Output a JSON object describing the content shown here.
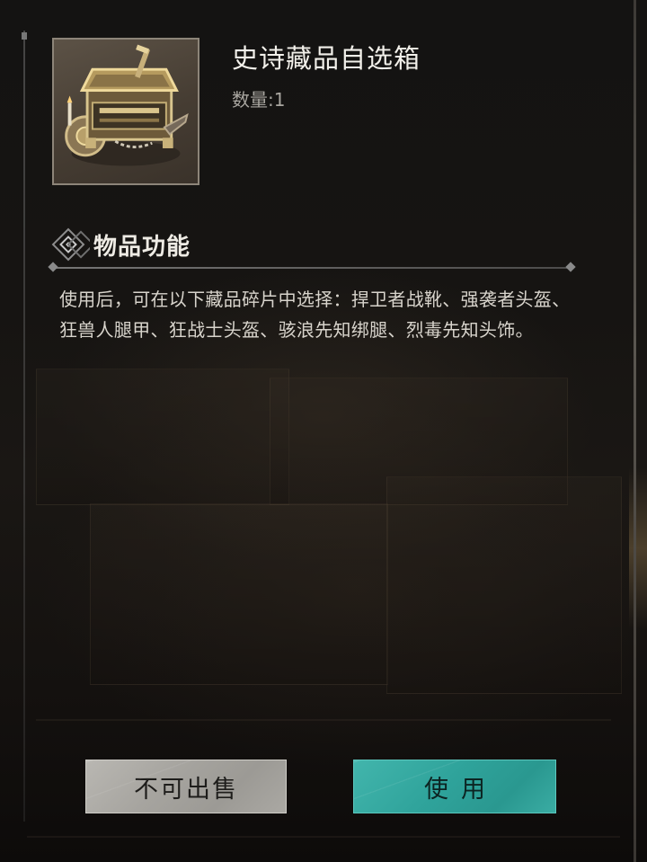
{
  "item": {
    "name": "史诗藏品自选箱",
    "quantity_label": "数量:1",
    "icon": "treasure-chest-icon"
  },
  "section": {
    "title": "物品功能",
    "icon": "diamond-emblem-icon"
  },
  "description": "使用后，可在以下藏品碎片中选择：捍卫者战靴、强袭者头盔、狂兽人腿甲、狂战士头盔、骇浪先知绑腿、烈毒先知头饰。",
  "buttons": {
    "cannot_sell_label": "不可出售",
    "use_label": "使用"
  },
  "colors": {
    "primary_button": "#2fa39b",
    "disabled_button": "#a6a49f",
    "text_primary": "#f2f0ea",
    "background": "#141312"
  }
}
